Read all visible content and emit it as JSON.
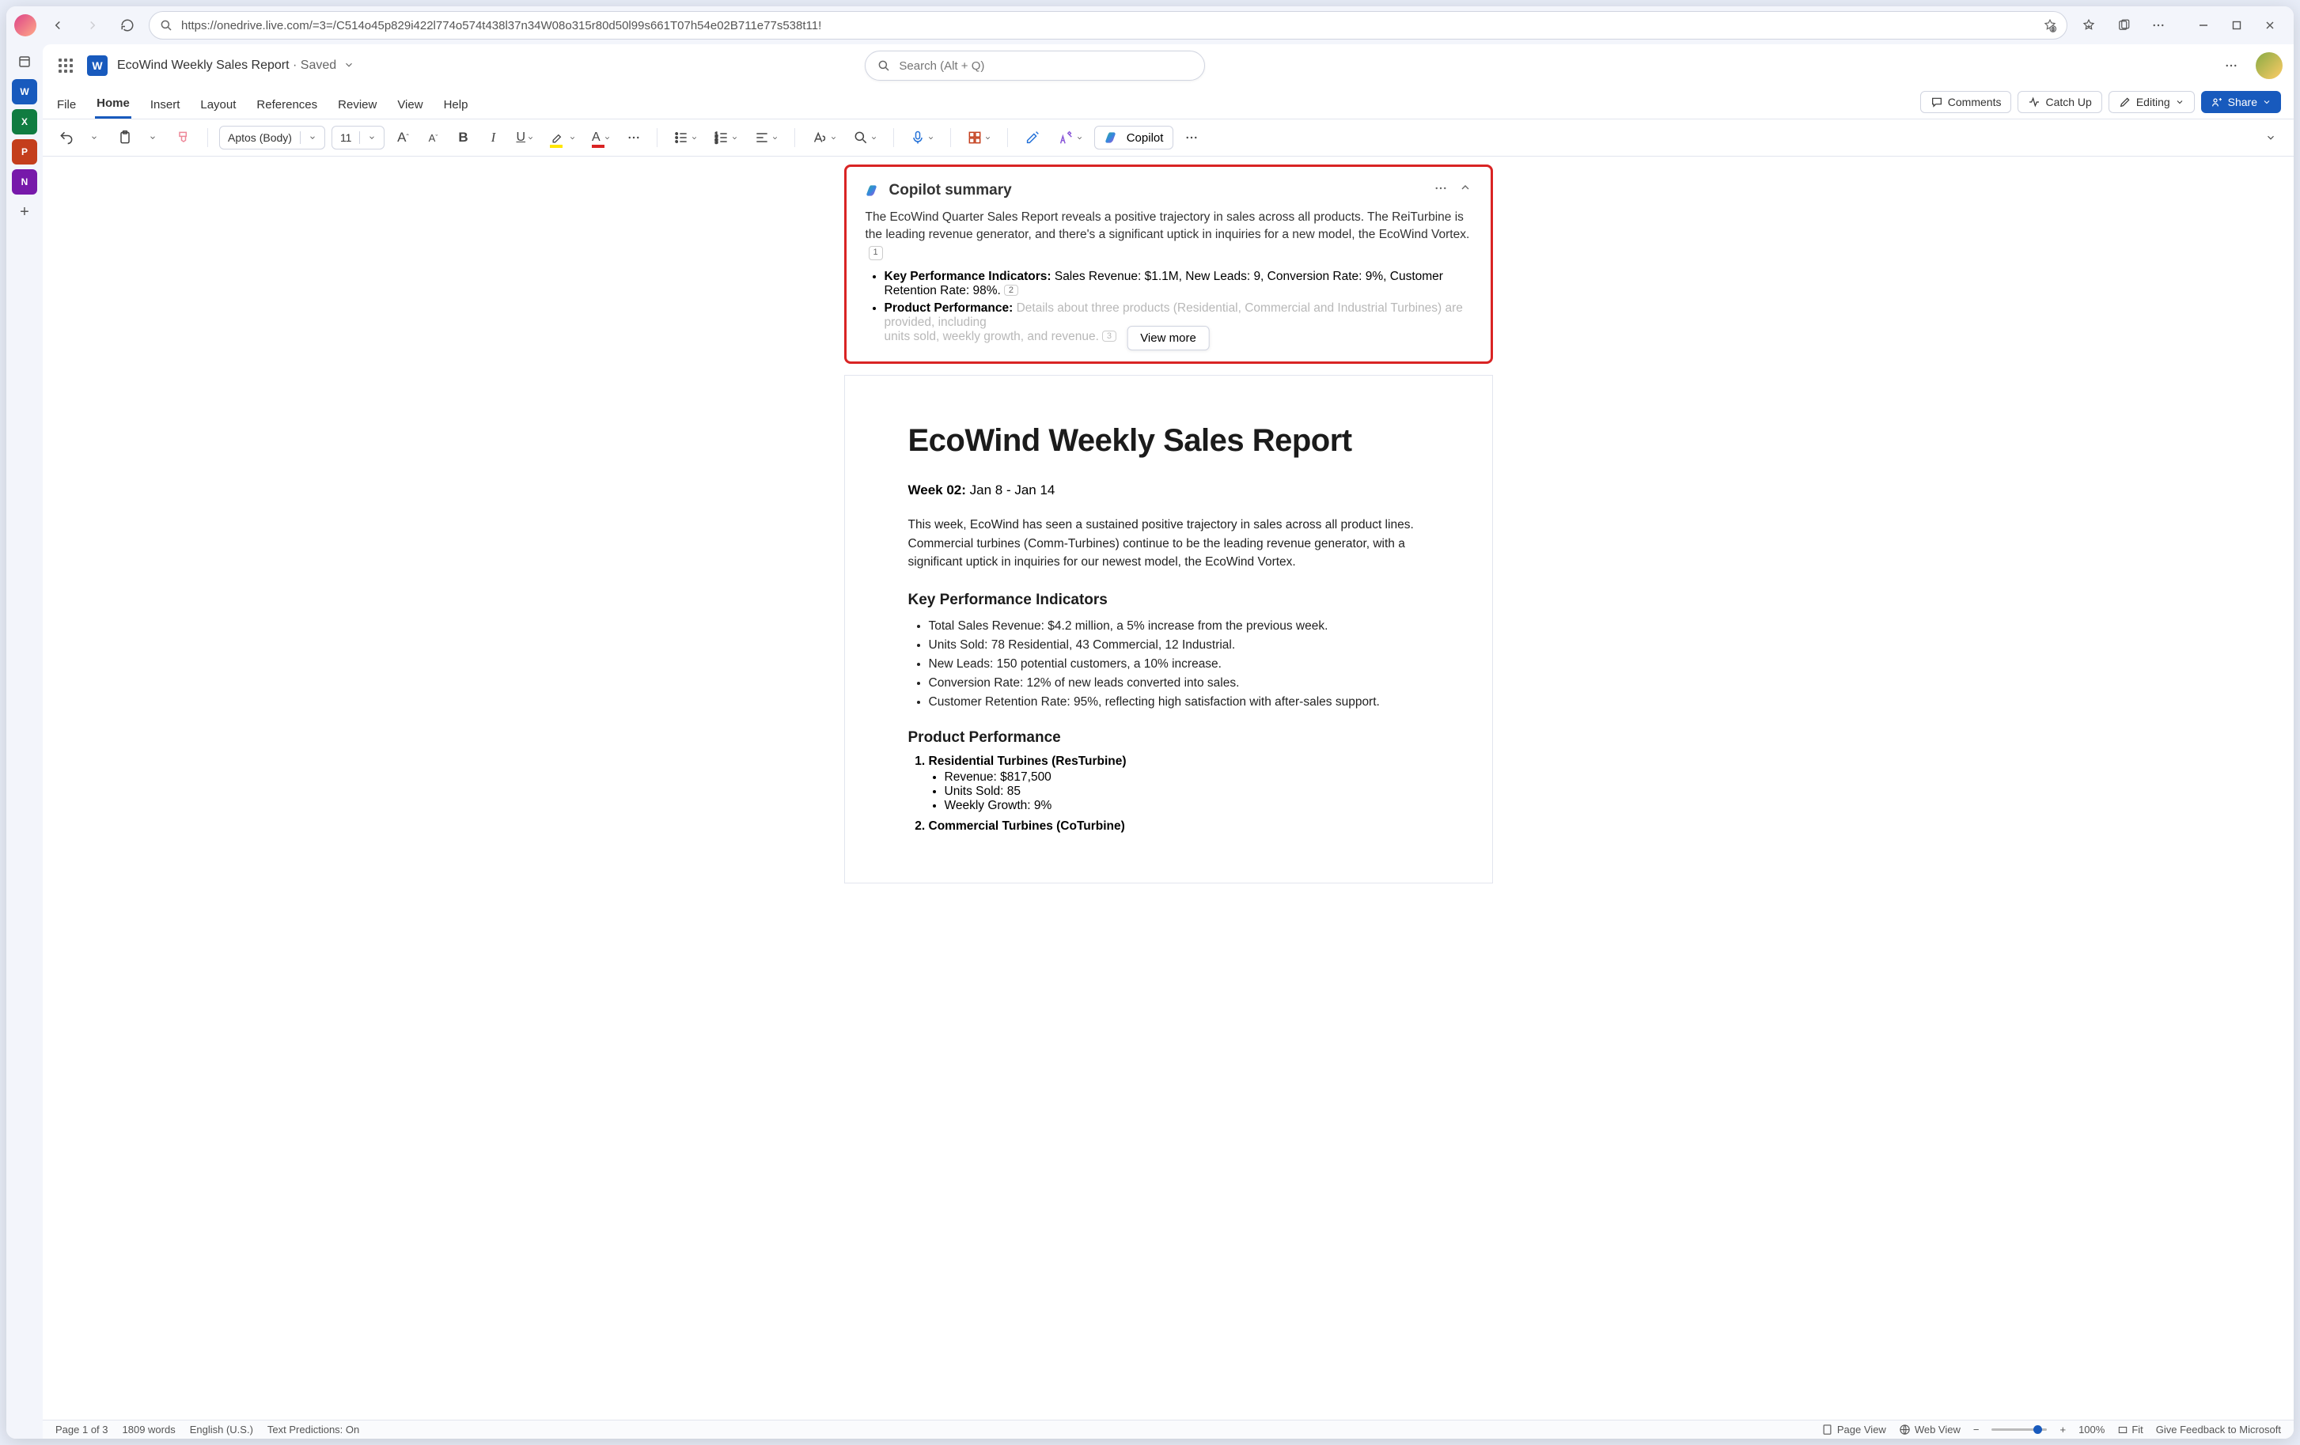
{
  "browser": {
    "url": "https://onedrive.live.com/=3=/C514o45p829i422l774o574t438l37n34W08o315r80d50l99s661T07h54e02B711e77s538t11!"
  },
  "sidebar_rail": [
    {
      "letter": "",
      "color": "#e8edf8",
      "type": "tab"
    },
    {
      "letter": "W",
      "color": "#185abd"
    },
    {
      "letter": "X",
      "color": "#107c41"
    },
    {
      "letter": "P",
      "color": "#c43e1c"
    },
    {
      "letter": "N",
      "color": "#7719aa"
    }
  ],
  "app": {
    "doc_title": "EcoWind Weekly Sales Report",
    "saved_label": " · Saved",
    "search_placeholder": "Search (Alt + Q)"
  },
  "ribbon": {
    "tabs": [
      "File",
      "Home",
      "Insert",
      "Layout",
      "References",
      "Review",
      "View",
      "Help"
    ],
    "active_index": 1,
    "comments_label": "Comments",
    "catchup_label": "Catch Up",
    "editing_label": "Editing",
    "share_label": "Share"
  },
  "toolbar": {
    "font_name": "Aptos (Body)",
    "font_size": "11",
    "copilot_label": "Copilot"
  },
  "copilot_summary": {
    "title": "Copilot summary",
    "intro": "The EcoWind Quarter Sales Report reveals a positive trajectory in sales across all products. The ReiTurbine is the leading revenue generator, and there's a significant uptick in inquiries for a new model, the EcoWind Vortex.",
    "intro_ref": "1",
    "bullets": [
      {
        "label": "Key Performance Indicators:",
        "text": " Sales Revenue: $1.1M, New Leads: 9, Conversion Rate: 9%, Customer Retention Rate: 98%.",
        "ref": "2"
      },
      {
        "label": "Product Performance:",
        "text_visible": " Details about three products (R",
        "text_faded": "esidential, Commercial and Industrial Turbines) are provided, including",
        "fade_line2": "units sold, weekly growth, and revenue.",
        "ref": "3"
      }
    ],
    "view_more_label": "View more"
  },
  "document": {
    "title": "EcoWind Weekly Sales Report",
    "week_label": "Week 02:",
    "week_range": " Jan 8 - Jan 14",
    "intro_para": "This week, EcoWind has seen a sustained positive trajectory in sales across all product lines. Commercial turbines (Comm-Turbines) continue to be the leading revenue generator, with a significant uptick in inquiries for our newest model, the EcoWind Vortex.",
    "kpi_heading": "Key Performance Indicators",
    "kpi_items": [
      "Total Sales Revenue: $4.2 million, a 5% increase from the previous week.",
      "Units Sold: 78 Residential, 43 Commercial, 12 Industrial.",
      "New Leads: 150 potential customers, a 10% increase.",
      "Conversion Rate: 12% of new leads converted into sales.",
      "Customer Retention Rate: 95%, reflecting high satisfaction with after-sales support."
    ],
    "prod_heading": "Product Performance",
    "products": [
      {
        "name": "Residential Turbines (ResTurbine)",
        "metrics": [
          "Revenue: $817,500",
          "Units Sold: 85",
          "Weekly Growth: 9%"
        ]
      },
      {
        "name": "Commercial Turbines (CoTurbine)",
        "metrics": []
      }
    ]
  },
  "statusbar": {
    "page": "Page 1 of 3",
    "words": "1809 words",
    "lang": "English (U.S.)",
    "predictions": "Text Predictions: On",
    "page_view": "Page View",
    "web_view": "Web View",
    "zoom_pct": "100%",
    "fit": "Fit",
    "feedback": "Give Feedback to Microsoft"
  }
}
